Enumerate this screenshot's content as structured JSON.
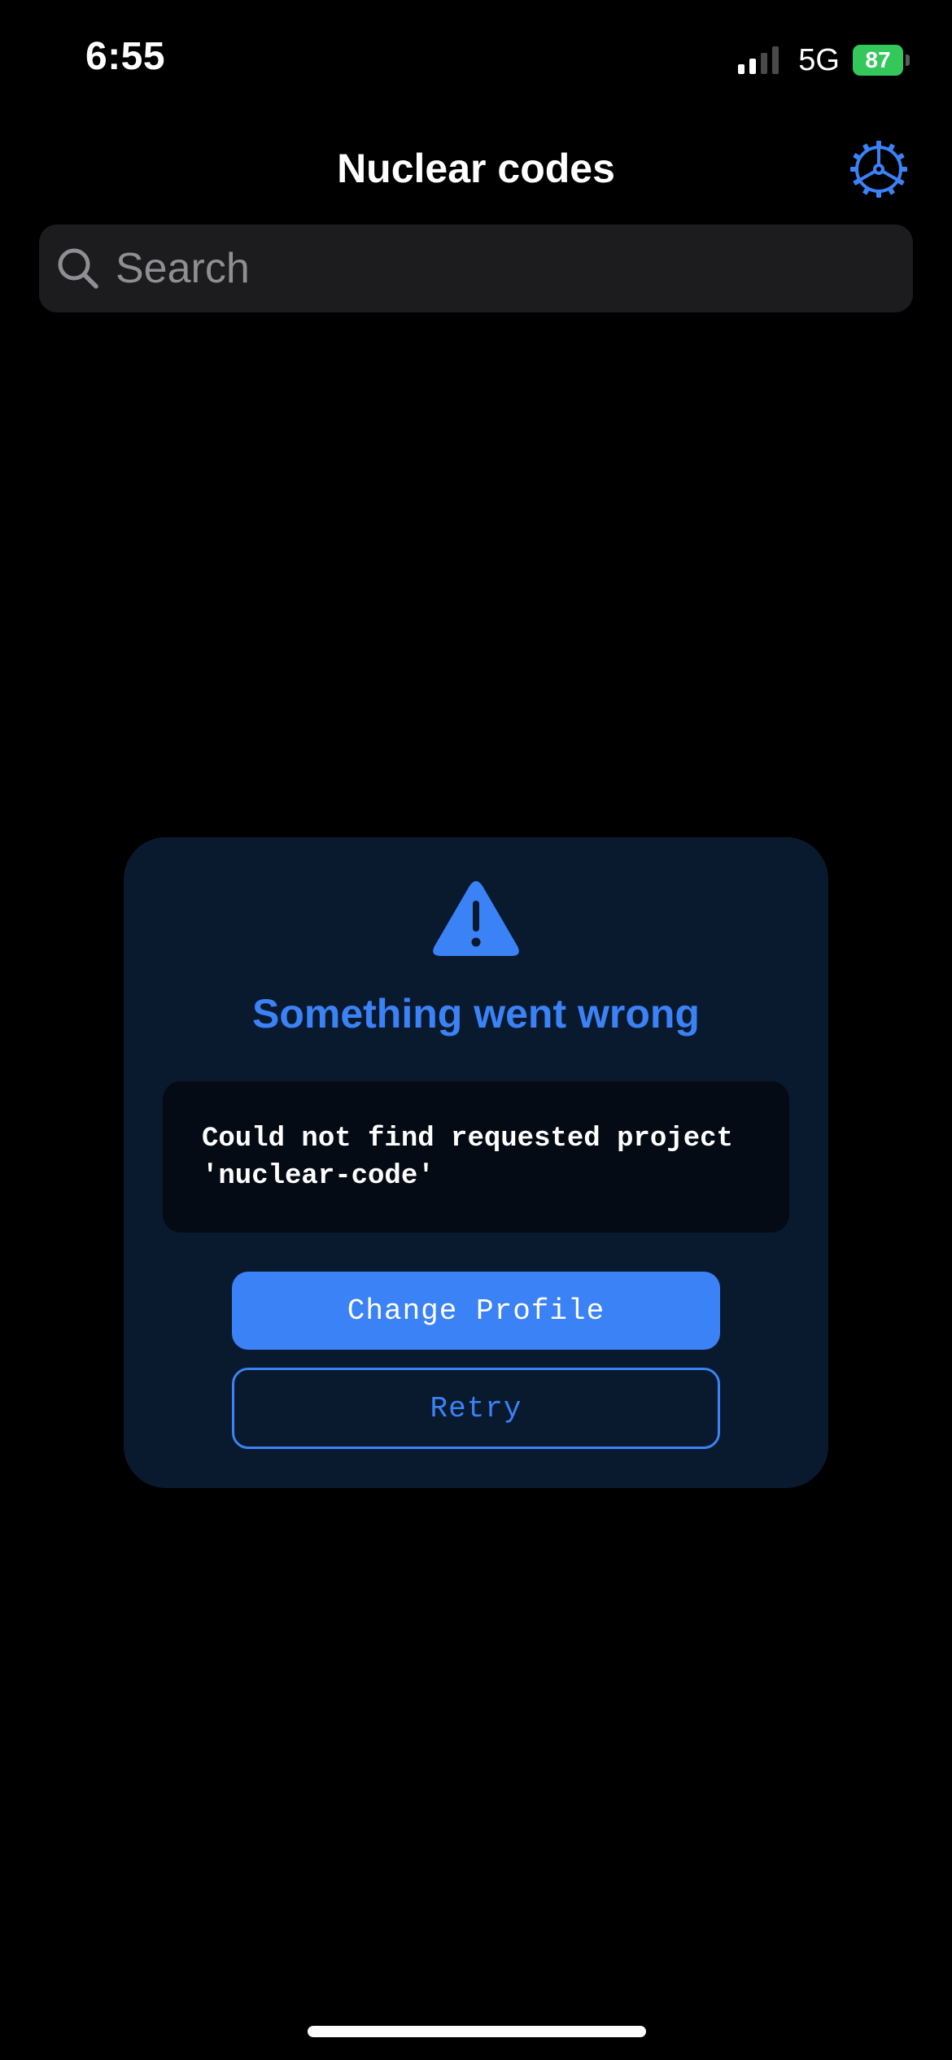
{
  "status_bar": {
    "time": "6:55",
    "network": "5G",
    "battery_level": "87",
    "signal_bars_active": 2,
    "signal_bars_total": 4
  },
  "header": {
    "title": "Nuclear codes",
    "settings_icon": "gear-icon"
  },
  "search": {
    "placeholder": "Search",
    "value": "",
    "icon": "search-icon"
  },
  "error_card": {
    "icon": "warning-icon",
    "title": "Something went wrong",
    "message": "Could not find requested project 'nuclear-code'",
    "primary_button_label": "Change Profile",
    "secondary_button_label": "Retry"
  },
  "colors": {
    "accent": "#3b82f6",
    "background": "#000000",
    "card_background": "#0a1a2e",
    "battery": "#34c759"
  }
}
